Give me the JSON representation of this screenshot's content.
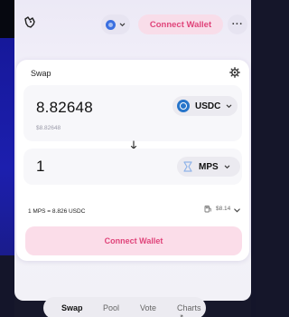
{
  "header": {
    "logo_icon": "uniswap-unicorn-icon",
    "network_icon": "ethereum-network-icon",
    "connect_wallet": "Connect Wallet",
    "more_label": "···"
  },
  "swap": {
    "title": "Swap",
    "settings_icon": "gear-icon",
    "input": {
      "amount": "8.82648",
      "usd_value": "$8.82648",
      "token": "USDC"
    },
    "output": {
      "amount": "1",
      "token": "MPS"
    },
    "rate": "1 MPS = 8.826 USDC",
    "gas": "$8.14",
    "action_button": "Connect Wallet"
  },
  "bottom_nav": {
    "items": [
      "Swap",
      "Pool",
      "Vote",
      "Charts ↗"
    ],
    "active": "Swap"
  },
  "colors": {
    "accent_pink": "#e0447a",
    "pink_bg": "#fbdde9",
    "usdc_blue": "#2775ca",
    "page_bg": "#f2f1f7"
  }
}
